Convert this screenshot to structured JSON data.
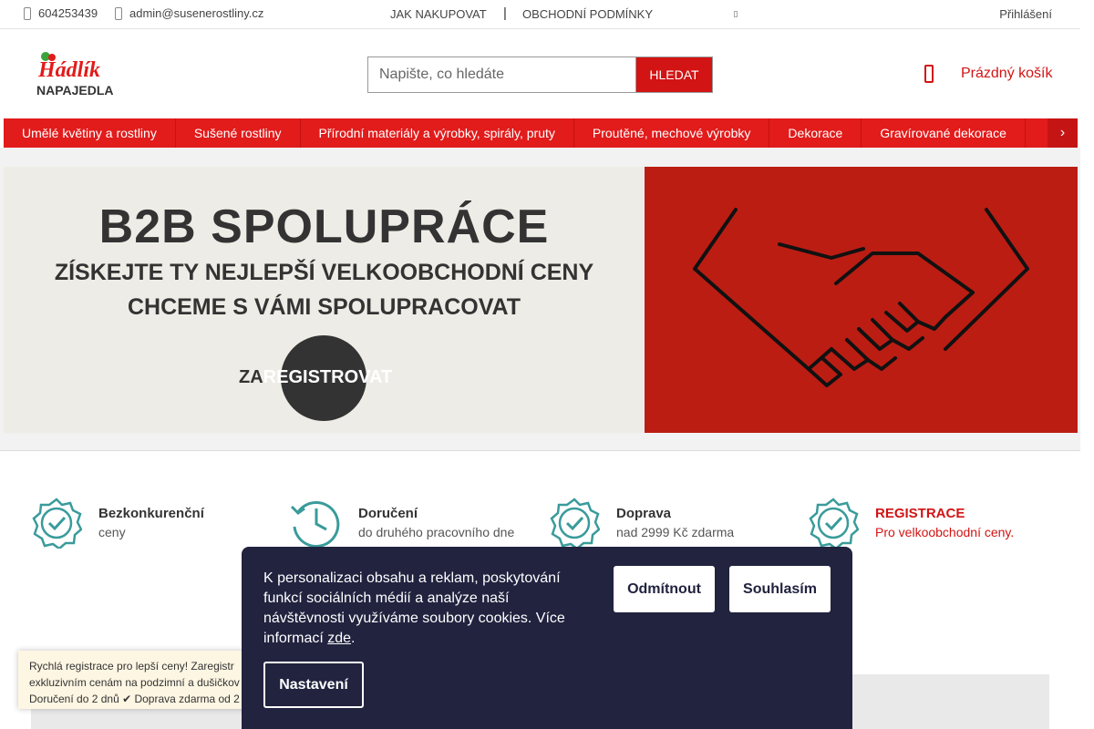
{
  "topbar": {
    "phone": "604253439",
    "email": "admin@susenerostliny.cz",
    "nav": [
      "JAK NAKUPOVAT",
      "OBCHODNÍ PODMÍNKY"
    ],
    "separator": "|",
    "login": "Přihlášení"
  },
  "logo": {
    "top": "Hádlík",
    "bottom": "NAPAJEDLA"
  },
  "search": {
    "placeholder": "Napište, co hledáte",
    "button": "HLEDAT"
  },
  "cart": {
    "label": "Prázdný košík"
  },
  "menu": {
    "items": [
      "Umělé květiny a rostliny",
      "Sušené rostliny",
      "Přírodní materiály a výrobky, spirály, pruty",
      "Proutěné, mechové výrobky",
      "Dekorace",
      "Gravírované dekorace"
    ],
    "more_icon": "chevron-icon"
  },
  "banner": {
    "title": "B2B SPOLUPRÁCE",
    "line1": "ZÍSKEJTE TY NEJLEPŠÍ VELKOOBCHODNÍ CENY",
    "line2": "CHCEME S VÁMI SPOLUPRACOVAT",
    "cta_a": "ZA",
    "cta_b": "REGISTROVAT",
    "colors": {
      "left": "#eeece6",
      "right": "#bb1d13"
    }
  },
  "benefits": [
    {
      "title": "Bezkonkurenční",
      "sub": "ceny",
      "icon": "badge-check-icon"
    },
    {
      "title": "Doručení",
      "sub": "do druhého pracovního dne",
      "icon": "clock-icon"
    },
    {
      "title": "Doprava",
      "sub": "nad 2999 Kč zdarma",
      "icon": "badge-check-icon"
    },
    {
      "title": "REGISTRACE",
      "sub": "Pro velkoobchodní ceny.",
      "icon": "badge-check-icon"
    }
  ],
  "notice": {
    "line1": "Rychlá registrace pro lepší ceny! Zaregistr",
    "line2": "exkluzivním cenám na podzimní a dušičkov",
    "line3": "Doručení do 2 dnů ✔ Doprava zdarma od 2"
  },
  "cookie": {
    "text": "K personalizaci obsahu a reklam, poskytování funkcí sociálních médií a analýze naší návštěvnosti využíváme soubory cookies. Více informací ",
    "link": "zde",
    "period": ".",
    "decline": "Odmítnout",
    "accept": "Souhlasím",
    "settings": "Nastavení"
  }
}
